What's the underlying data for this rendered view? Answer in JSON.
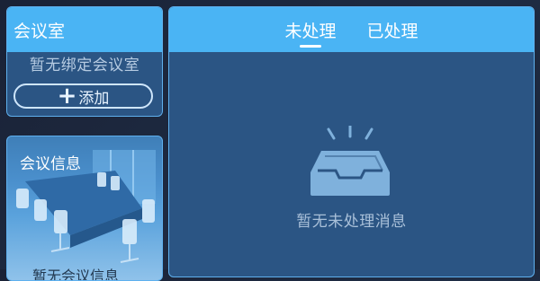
{
  "meeting_room": {
    "title": "会议室",
    "empty_text": "暂无绑定会议室",
    "add_label": "添加"
  },
  "meeting_info": {
    "title": "会议信息",
    "partial_text": "暂无会议信息"
  },
  "messages": {
    "tabs": [
      {
        "label": "未处理",
        "active": true
      },
      {
        "label": "已处理",
        "active": false
      }
    ],
    "empty_text": "暂无未处理消息",
    "empty_icon": "empty-tray-icon"
  },
  "colors": {
    "header_blue": "#4ab4f4",
    "panel_bg": "#2b5584",
    "page_bg": "#1e2c44"
  }
}
